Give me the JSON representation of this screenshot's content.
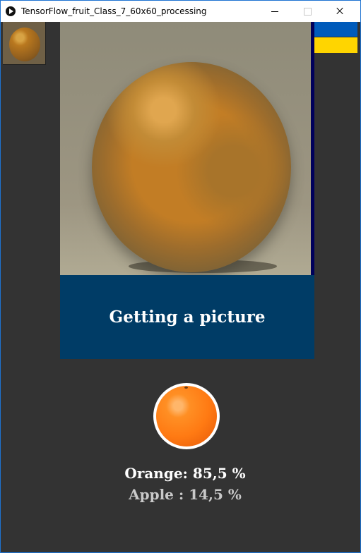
{
  "window": {
    "title": "TensorFlow_fruit_Class_7_60x60_processing"
  },
  "status": {
    "text": "Getting a picture"
  },
  "flag": {
    "colors": [
      "#005bbb",
      "#ffd500"
    ]
  },
  "predictions": [
    {
      "label": "Orange: 85,5 %",
      "name": "Orange",
      "value": 85.5,
      "color": "#ffffff"
    },
    {
      "label": "Apple : 14,5 %",
      "name": "Apple",
      "value": 14.5,
      "color": "#c9c9c9"
    }
  ],
  "icons": {
    "app": "processing-play-icon",
    "minimize": "minimize-icon",
    "maximize": "maximize-icon",
    "close": "close-icon"
  }
}
